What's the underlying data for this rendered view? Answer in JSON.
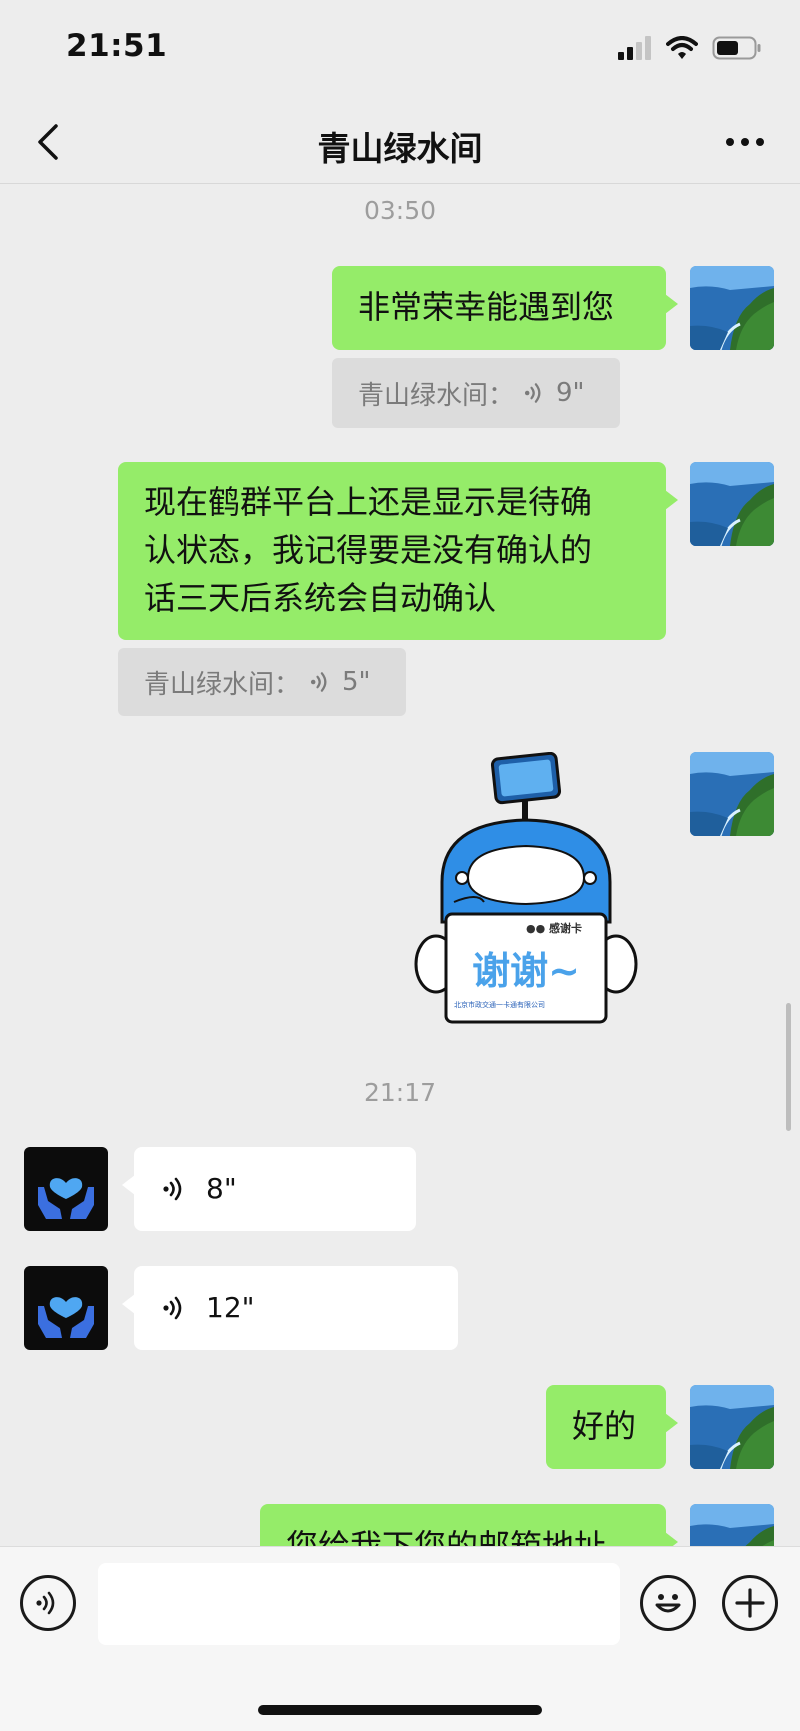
{
  "status_bar": {
    "time": "21:51"
  },
  "header": {
    "title": "青山绿水间"
  },
  "timestamps": [
    "03:50",
    "21:17"
  ],
  "messages": {
    "m1": {
      "text": "非常荣幸能遇到您"
    },
    "q1": {
      "sender": "青山绿水间：",
      "duration": "9\""
    },
    "m2": {
      "line1": "现在鹤群平台上还是显示是待确",
      "line2": "认状态，我记得要是没有确认的",
      "line3": "话三天后系统会自动确认"
    },
    "q2": {
      "sender": "青山绿水间：",
      "duration": "5\""
    },
    "sticker": {
      "card_header": "●● 感谢卡",
      "card_text": "谢谢~",
      "card_footer": "北京市政交通一卡通有限公司"
    },
    "v1": {
      "duration": "8\""
    },
    "v2": {
      "duration": "12\""
    },
    "m3": {
      "text": "好的"
    },
    "m4": {
      "text": "您给我下您的邮箱地址"
    }
  },
  "icons": {
    "back": "chevron-left-icon",
    "more": "more-dots-icon",
    "voice": "voice-wave-icon",
    "emoji": "emoji-icon",
    "add": "plus-icon"
  },
  "colors": {
    "bubble_sent": "#95ec69",
    "bubble_received": "#ffffff",
    "background": "#ededed",
    "quote_bg": "#dcdcdc"
  }
}
